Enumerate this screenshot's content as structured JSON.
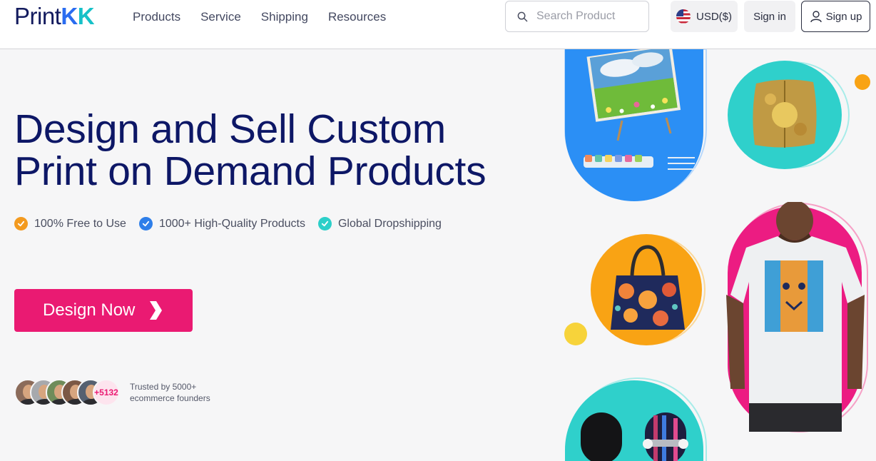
{
  "brand": {
    "logo_text_a": "Print",
    "logo_text_b": "K",
    "logo_text_c": "K"
  },
  "nav": {
    "items": [
      {
        "label": "Products"
      },
      {
        "label": "Service"
      },
      {
        "label": "Shipping"
      },
      {
        "label": "Resources"
      }
    ]
  },
  "search": {
    "placeholder": "Search Product"
  },
  "currency": {
    "label": "USD($)"
  },
  "auth": {
    "signin": "Sign in",
    "signup": "Sign up"
  },
  "hero": {
    "title_line1": "Design and Sell Custom",
    "title_line2": "Print on Demand Products",
    "features": [
      {
        "label": "100% Free to Use",
        "color": "#f39a1f"
      },
      {
        "label": "1000+ High-Quality Products",
        "color": "#2e7ee9"
      },
      {
        "label": "Global Dropshipping",
        "color": "#2ccfc9"
      }
    ],
    "cta_label": "Design Now"
  },
  "trust": {
    "count": "+5132",
    "line1": "Trusted by 5000+",
    "line2": "ecommerce founders"
  },
  "colors": {
    "brand_navy": "#0d1766",
    "accent_pink": "#ea1a72",
    "blue": "#2b8ff5",
    "teal": "#2fd0cb",
    "orange": "#f9a314",
    "yellow": "#f7d33a"
  }
}
